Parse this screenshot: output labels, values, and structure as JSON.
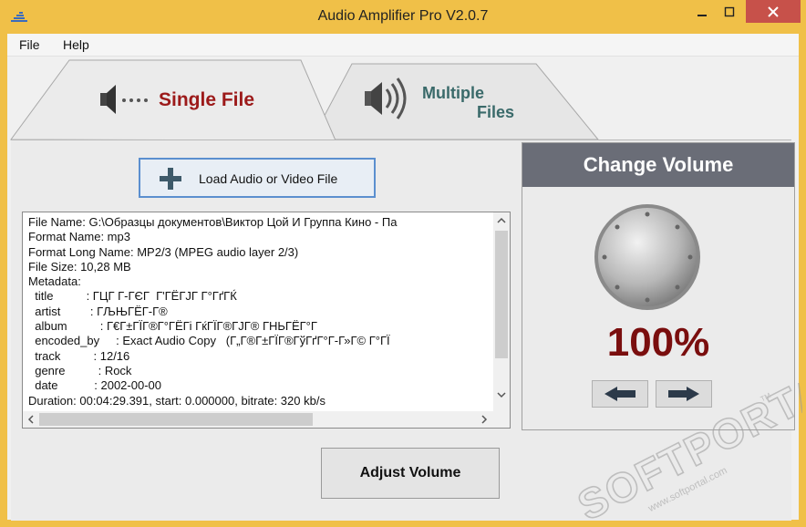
{
  "window": {
    "title": "Audio Amplifier Pro V2.0.7",
    "controls": [
      "minimize-icon",
      "maximize-icon",
      "close-icon"
    ]
  },
  "menu": {
    "file": "File",
    "help": "Help"
  },
  "tabs": {
    "single": "Single File",
    "multiple_line1": "Multiple",
    "multiple_line2": "Files"
  },
  "load_button": {
    "label": "Load Audio or Video File",
    "icon": "plus-icon"
  },
  "file_info": {
    "lines": [
      "File Name: G:\\Образцы документов\\Виктор Цой И Группа Кино - Па",
      "Format Name: mp3",
      "Format Long Name: MP2/3 (MPEG audio layer 2/3)",
      "File Size: 10,28 MB",
      "Metadata:",
      "  title          : ГЦГ Г-ГЄГ  Г'ГЁГЈГ Г°ГґГЌ",
      "  artist         : ГЉЊГЁГ-Г®",
      "  album          : Г€Г±ГЇГ®Г°ГЁГі ГќГЇГ®ГЈГ® ГНЬГЁГ°Г",
      "  encoded_by     : Exact Audio Copy   (Г„Г®Г±ГЇГ®ГўГґГ°Г-Г»Г© Г°ГЇ",
      "  track          : 12/16",
      "  genre          : Rock",
      "  date           : 2002-00-00",
      "Duration: 00:04:29.391, start: 0.000000, bitrate: 320 kb/s"
    ]
  },
  "volume": {
    "header": "Change Volume",
    "percent": "100%",
    "level": 1.0,
    "decrease_icon": "arrow-left-icon",
    "increase_icon": "arrow-right-icon"
  },
  "adjust_button": {
    "label": "Adjust Volume"
  },
  "watermark": {
    "text": "SOFTPORTAL",
    "url": "www.softportal.com",
    "tm": "TM"
  },
  "colors": {
    "frame": "#f0c048",
    "close": "#c7514a",
    "single_tab_text": "#9c1a1a",
    "multi_tab_text": "#3a6a6a",
    "volume_header": "#6a6d77",
    "volume_text": "#7a0e0e"
  }
}
